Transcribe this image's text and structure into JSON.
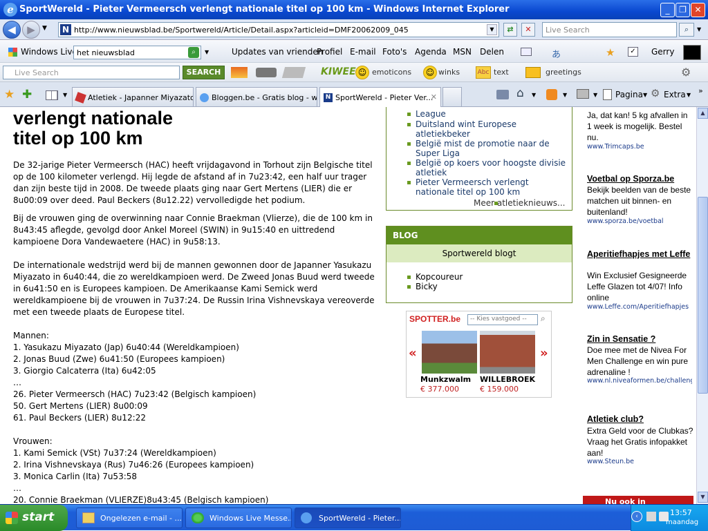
{
  "window": {
    "title": "SportWereld - Pieter Vermeersch verlengt nationale titel op 100 km - Windows Internet Explorer",
    "min": "_",
    "max": "❐",
    "close": "✕"
  },
  "addr": {
    "url": "http://www.nieuwsblad.be/Sportwereld/Article/Detail.aspx?articleid=DMF20062009_045",
    "search_placeholder": "Live Search"
  },
  "wl": {
    "brand": "Windows Live",
    "query": "het nieuwsblad",
    "items": [
      "Updates van vrienden",
      "Profiel",
      "E-mail",
      "Foto's",
      "Agenda",
      "MSN",
      "Delen"
    ],
    "user": "Gerry"
  },
  "searchtb": {
    "placeholder": "Live Search",
    "go": "SEARCH",
    "brand": "KIWEE",
    "emoticons": "emoticons",
    "winks": "winks",
    "text": "text",
    "greetings": "greetings"
  },
  "tabs": [
    "Atletiek - Japanner Miyazato ...",
    "Bloggen.be - Gratis blog - we...",
    "SportWereld - Pieter Ver..."
  ],
  "cmd": {
    "pagina": "Pagina",
    "extra": "Extra"
  },
  "article": {
    "headline": [
      "verlengt nationale",
      "titel op 100 km"
    ],
    "p1": "De 32-jarige Pieter Vermeersch (HAC) heeft vrijdagavond in Torhout zijn Belgische titel op de 100 kilometer verlengd. Hij legde de afstand af in 7u23:42, een half uur trager dan zijn beste tijd in 2008. De tweede plaats ging naar Gert Mertens (LIER) die er 8u00:09 over deed. Paul Beckers (8u12.22) vervolledigde het podium.",
    "p2": "Bij de vrouwen ging de overwinning naar Connie Braekman (Vlierze), die de 100 km in 8u43:45 aflegde, gevolgd door Ankel Moreel (SWIN) in 9u15:40 en uittredend kampioene Dora Vandewaetere (HAC) in 9u58:13.",
    "p3": "De internationale wedstrijd werd bij de mannen gewonnen door de Japanner Yasukazu Miyazato in 6u40:44, die zo wereldkampioen werd. De Zweed Jonas Buud werd tweede in 6u41:50 en is Europees kampioen. De Amerikaanse Kami Semick werd wereldkampioene bij de vrouwen in 7u37:24. De Russin Irina Vishnevskaya vereoverde met een tweede plaats de Europese titel.",
    "men_title": "Mannen:",
    "men": [
      "1. Yasukazu Miyazato (Jap) 6u40:44 (Wereldkampioen)",
      "2. Jonas Buud (Zwe) 6u41:50 (Europees kampioen)",
      "3. Giorgio Calcaterra (Ita) 6u42:05",
      "…",
      "26. Pieter Vermeersch (HAC) 7u23:42 (Belgisch kampioen)",
      "50. Gert Mertens (LIER) 8u00:09",
      "61. Paul Beckers (LIER) 8u12:22"
    ],
    "women_title": "Vrouwen:",
    "women": [
      "1. Kami Semick (VSt) 7u37:24 (Wereldkampioen)",
      "2. Irina Vishnevskaya (Rus) 7u46:26 (Europees kampioen)",
      "3. Monica Carlin (Ita) 7u53:58",
      "…",
      "20. Connie Braekman (VLIERZE)8u43:45 (Belgisch kampioen)"
    ]
  },
  "news": {
    "items": [
      "League",
      "Duitsland wint Europese atletiekbeker",
      "België mist de promotie naar de Super Liga",
      "België op koers voor hoogste divisie atletiek",
      "Pieter Vermeersch verlengt nationale titel op 100 km"
    ],
    "more": "Meer atletieknieuws..."
  },
  "blog": {
    "header": "BLOG",
    "sub": "Sportwereld blogt",
    "items": [
      "Kopcoureur",
      "Bicky"
    ]
  },
  "spotter": {
    "logo": "SPOTTER.be",
    "select": "-- Kies vastgoed --",
    "listings": [
      {
        "city": "Munkzwalm",
        "price": "€ 377.000"
      },
      {
        "city": "WILLEBROEK",
        "price": "€ 159.000"
      }
    ]
  },
  "ads": [
    {
      "title": "",
      "body": "Ja, dat kan! 5 kg afvallen in 1 week is mogelijk. Bestel nu.",
      "url": "www.Trimcaps.be"
    },
    {
      "title": "Voetbal op Sporza.be",
      "body": "Bekijk beelden van de beste matchen uit binnen- en buitenland!",
      "url": "www.sporza.be/voetbal"
    },
    {
      "title": "Aperitiefhapjes met Leffe",
      "body": "Win Exclusief Gesigneerde Leffe Glazen tot 4/07! Info online",
      "url": "www.Leffe.com/Aperitiefhapjes"
    },
    {
      "title": "Zin in Sensatie ?",
      "body": "Doe mee met de Nivea For Men Challenge en win pure adrenaline !",
      "url": "www.nl.niveaformen.be/challenge"
    },
    {
      "title": "Atletiek club?",
      "body": "Extra Geld voor de Clubkas? Vraag het Gratis infopakket aan!",
      "url": "www.Steun.be"
    }
  ],
  "ad_bottom": "Nu ook in",
  "taskbar": {
    "start": "start",
    "buttons": [
      "Ongelezen e-mail - ...",
      "Windows Live Messe...",
      "SportWereld - Pieter..."
    ],
    "time": "13:57",
    "day": "maandag"
  }
}
